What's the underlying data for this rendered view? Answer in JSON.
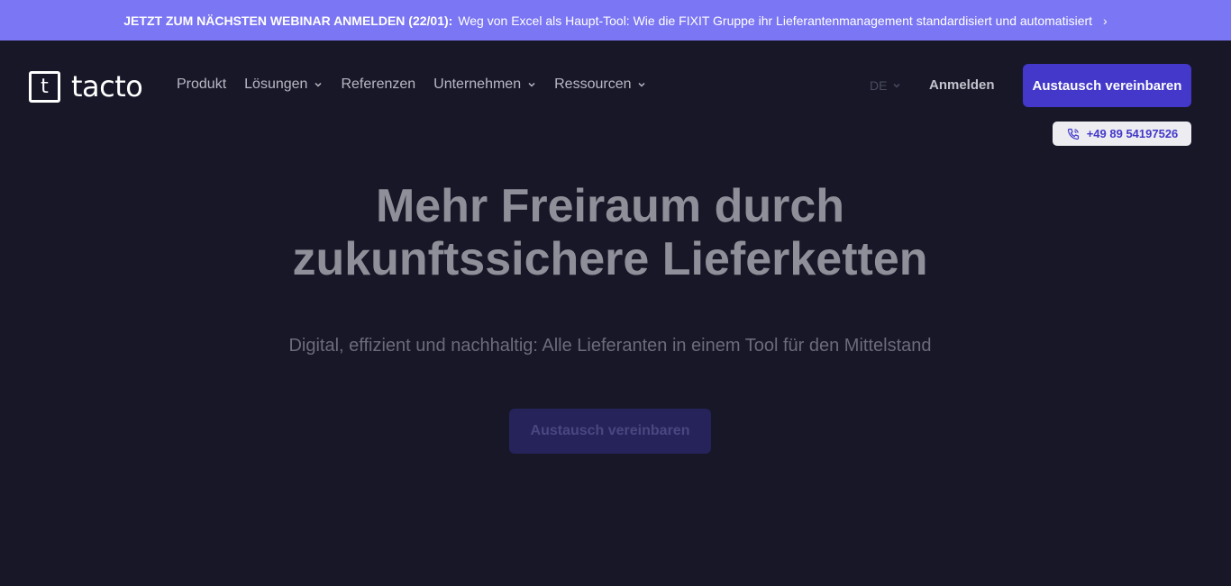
{
  "banner": {
    "strong": "JETZT ZUM NÄCHSTEN WEBINAR ANMELDEN (22/01):",
    "text": "Weg von Excel als Haupt-Tool: Wie die FIXIT Gruppe ihr Lieferantenmanagement standardisiert und automatisiert",
    "chevron": "›"
  },
  "logo": {
    "mark": "t",
    "text": "tacto"
  },
  "nav": {
    "items": [
      {
        "label": "Produkt",
        "dropdown": false
      },
      {
        "label": "Lösungen",
        "dropdown": true
      },
      {
        "label": "Referenzen",
        "dropdown": false
      },
      {
        "label": "Unternehmen",
        "dropdown": true
      },
      {
        "label": "Ressourcen",
        "dropdown": true
      }
    ]
  },
  "header": {
    "language": "DE",
    "login": "Anmelden",
    "cta": "Austausch vereinbaren",
    "phone": "+49 89 54197526"
  },
  "hero": {
    "title_line1": "Mehr Freiraum durch",
    "title_line2": "zukunftssichere Lieferketten",
    "subtitle": "Digital, effizient und nachhaltig: Alle Lieferanten in einem Tool für den Mittelstand",
    "cta": "Austausch vereinbaren"
  },
  "colors": {
    "background": "#171728",
    "banner": "#7b76f3",
    "accent": "#4338ca"
  }
}
